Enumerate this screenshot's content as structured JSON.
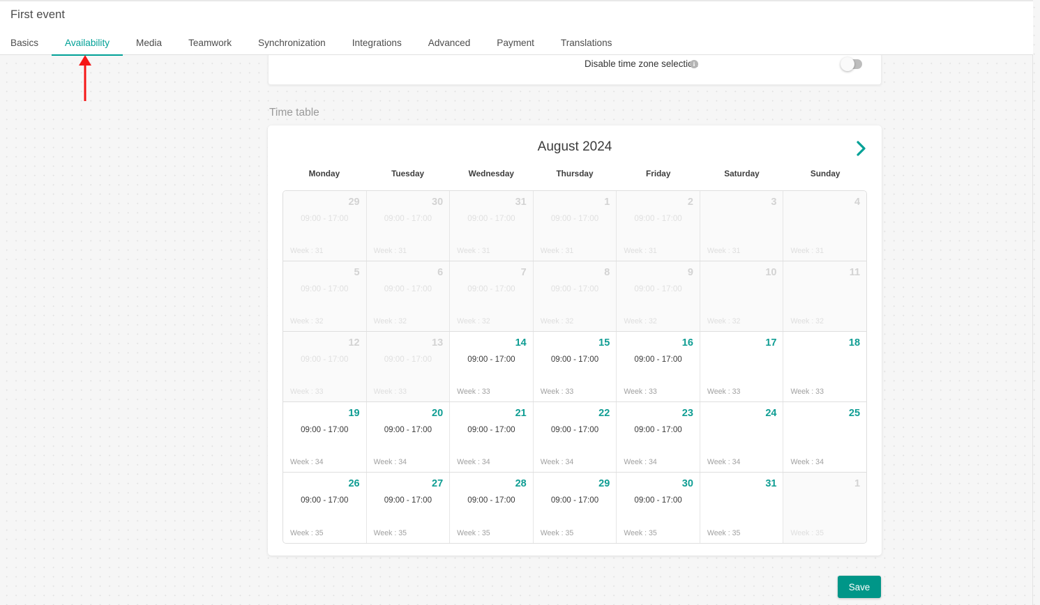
{
  "header": {
    "title": "First event",
    "tabs": [
      {
        "label": "Basics",
        "active": false
      },
      {
        "label": "Availability",
        "active": true
      },
      {
        "label": "Media",
        "active": false
      },
      {
        "label": "Teamwork",
        "active": false
      },
      {
        "label": "Synchronization",
        "active": false
      },
      {
        "label": "Integrations",
        "active": false
      },
      {
        "label": "Advanced",
        "active": false
      },
      {
        "label": "Payment",
        "active": false
      },
      {
        "label": "Translations",
        "active": false
      }
    ]
  },
  "timezone_card": {
    "label": "Disable time zone selection",
    "info_icon": "info-icon",
    "info_glyph": "i",
    "toggle_state": "off"
  },
  "timetable": {
    "section_label": "Time table",
    "month_title": "August 2024",
    "next_icon": "chevron-right-icon",
    "weekdays": [
      "Monday",
      "Tuesday",
      "Wednesday",
      "Thursday",
      "Friday",
      "Saturday",
      "Sunday"
    ],
    "default_time": "09:00 - 17:00",
    "rows": [
      [
        {
          "day": "29",
          "time": "09:00 - 17:00",
          "week": "Week : 31",
          "enabled": false
        },
        {
          "day": "30",
          "time": "09:00 - 17:00",
          "week": "Week : 31",
          "enabled": false
        },
        {
          "day": "31",
          "time": "09:00 - 17:00",
          "week": "Week : 31",
          "enabled": false
        },
        {
          "day": "1",
          "time": "09:00 - 17:00",
          "week": "Week : 31",
          "enabled": false
        },
        {
          "day": "2",
          "time": "09:00 - 17:00",
          "week": "Week : 31",
          "enabled": false
        },
        {
          "day": "3",
          "time": "",
          "week": "Week : 31",
          "enabled": false
        },
        {
          "day": "4",
          "time": "",
          "week": "Week : 31",
          "enabled": false
        }
      ],
      [
        {
          "day": "5",
          "time": "09:00 - 17:00",
          "week": "Week : 32",
          "enabled": false
        },
        {
          "day": "6",
          "time": "09:00 - 17:00",
          "week": "Week : 32",
          "enabled": false
        },
        {
          "day": "7",
          "time": "09:00 - 17:00",
          "week": "Week : 32",
          "enabled": false
        },
        {
          "day": "8",
          "time": "09:00 - 17:00",
          "week": "Week : 32",
          "enabled": false
        },
        {
          "day": "9",
          "time": "09:00 - 17:00",
          "week": "Week : 32",
          "enabled": false
        },
        {
          "day": "10",
          "time": "",
          "week": "Week : 32",
          "enabled": false
        },
        {
          "day": "11",
          "time": "",
          "week": "Week : 32",
          "enabled": false
        }
      ],
      [
        {
          "day": "12",
          "time": "09:00 - 17:00",
          "week": "Week : 33",
          "enabled": false
        },
        {
          "day": "13",
          "time": "09:00 - 17:00",
          "week": "Week : 33",
          "enabled": false
        },
        {
          "day": "14",
          "time": "09:00 - 17:00",
          "week": "Week : 33",
          "enabled": true
        },
        {
          "day": "15",
          "time": "09:00 - 17:00",
          "week": "Week : 33",
          "enabled": true
        },
        {
          "day": "16",
          "time": "09:00 - 17:00",
          "week": "Week : 33",
          "enabled": true
        },
        {
          "day": "17",
          "time": "",
          "week": "Week : 33",
          "enabled": true
        },
        {
          "day": "18",
          "time": "",
          "week": "Week : 33",
          "enabled": true
        }
      ],
      [
        {
          "day": "19",
          "time": "09:00 - 17:00",
          "week": "Week : 34",
          "enabled": true
        },
        {
          "day": "20",
          "time": "09:00 - 17:00",
          "week": "Week : 34",
          "enabled": true
        },
        {
          "day": "21",
          "time": "09:00 - 17:00",
          "week": "Week : 34",
          "enabled": true
        },
        {
          "day": "22",
          "time": "09:00 - 17:00",
          "week": "Week : 34",
          "enabled": true
        },
        {
          "day": "23",
          "time": "09:00 - 17:00",
          "week": "Week : 34",
          "enabled": true
        },
        {
          "day": "24",
          "time": "",
          "week": "Week : 34",
          "enabled": true
        },
        {
          "day": "25",
          "time": "",
          "week": "Week : 34",
          "enabled": true
        }
      ],
      [
        {
          "day": "26",
          "time": "09:00 - 17:00",
          "week": "Week : 35",
          "enabled": true
        },
        {
          "day": "27",
          "time": "09:00 - 17:00",
          "week": "Week : 35",
          "enabled": true
        },
        {
          "day": "28",
          "time": "09:00 - 17:00",
          "week": "Week : 35",
          "enabled": true
        },
        {
          "day": "29",
          "time": "09:00 - 17:00",
          "week": "Week : 35",
          "enabled": true
        },
        {
          "day": "30",
          "time": "09:00 - 17:00",
          "week": "Week : 35",
          "enabled": true
        },
        {
          "day": "31",
          "time": "",
          "week": "Week : 35",
          "enabled": true
        },
        {
          "day": "1",
          "time": "",
          "week": "Week : 35",
          "enabled": false
        }
      ]
    ]
  },
  "footer": {
    "save_label": "Save"
  },
  "annotation": {
    "arrow_icon": "up-arrow-annotation",
    "color": "#f51616"
  },
  "colors": {
    "accent": "#009688",
    "accent_text": "#00a096",
    "day_number": "#0f9d93",
    "annotation_red": "#f51616"
  }
}
